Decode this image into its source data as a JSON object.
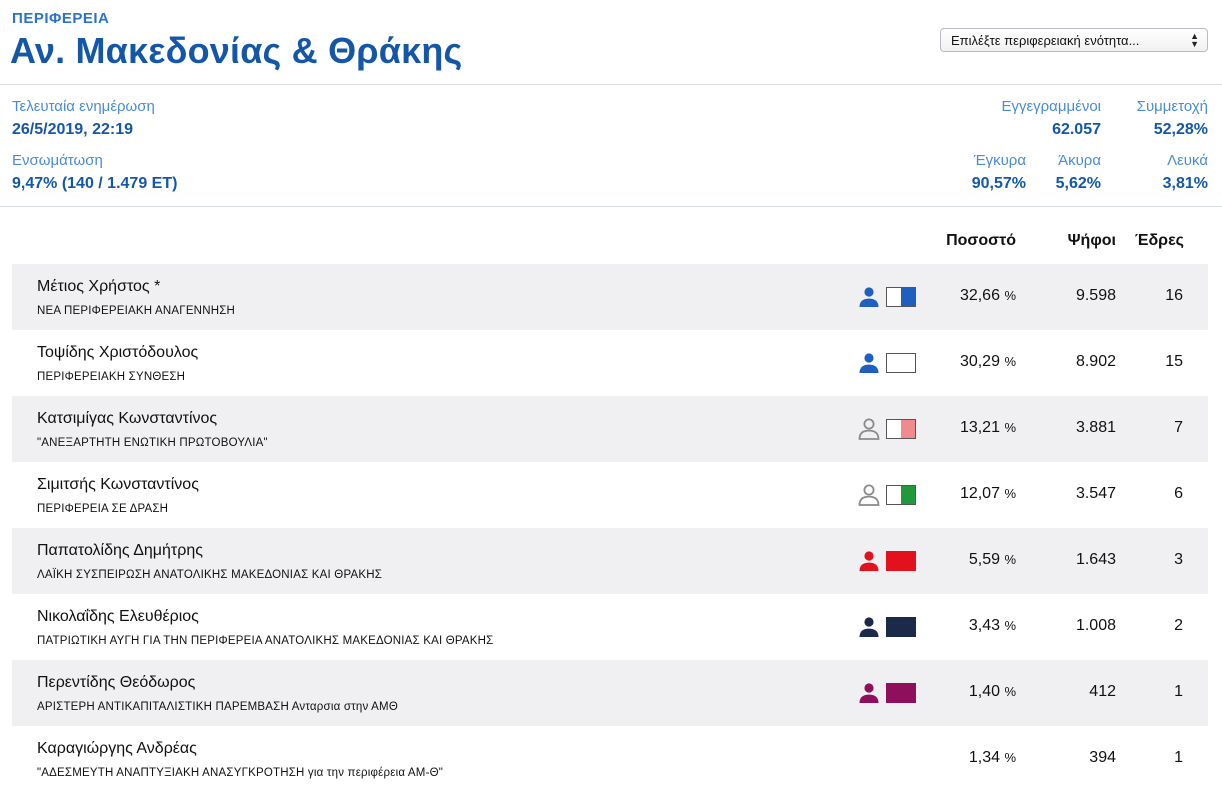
{
  "header": {
    "kicker": "ΠΕΡΙΦΕΡΕΙΑ",
    "title": "Αν. Μακεδονίας & Θράκης",
    "select_value": "Επιλέξτε περιφερειακή ενότητα..."
  },
  "stats": {
    "last_update_label": "Τελευταία ενημέρωση",
    "last_update_value": "26/5/2019, 22:19",
    "incorporation_label": "Ενσωμάτωση",
    "incorporation_value": "9,47% (140 / 1.479 ΕΤ)",
    "registered_label": "Εγγεγραμμένοι",
    "registered_value": "62.057",
    "turnout_label": "Συμμετοχή",
    "turnout_value": "52,28%",
    "valid_label": "Έγκυρα",
    "valid_value": "90,57%",
    "invalid_label": "Άκυρα",
    "invalid_value": "5,62%",
    "blank_label": "Λευκά",
    "blank_value": "3,81%"
  },
  "table": {
    "col_percent": "Ποσοστό",
    "col_votes": "Ψήφοι",
    "col_seats": "Έδρες",
    "percent_unit": "%",
    "rows": [
      {
        "name": "Μέτιος Χρήστος *",
        "party": "ΝΕΑ ΠΕΡΙΦΕΡΕΙΑΚΗ ΑΝΑΓΕΝΝΗΣΗ",
        "percent": "32,66",
        "votes": "9.598",
        "seats": "16",
        "icon": "person-icon",
        "icon_color": "#1f5fbf",
        "icon_filled": true,
        "swatch_color": "#1f5fbf",
        "swatch_share": 0.5
      },
      {
        "name": "Τοψίδης Χριστόδουλος",
        "party": "ΠΕΡΙΦΕΡΕΙΑΚΗ ΣΥΝΘΕΣΗ",
        "percent": "30,29",
        "votes": "8.902",
        "seats": "15",
        "icon": "person-icon",
        "icon_color": "#1f5fbf",
        "icon_filled": true,
        "swatch_color": "#ffffff",
        "swatch_share": 1
      },
      {
        "name": "Κατσιμίγας Κωνσταντίνος",
        "party": "\"ΑΝΕΞΑΡΤΗΤΗ ΕΝΩΤΙΚΗ ΠΡΩΤΟΒΟΥΛΙΑ\"",
        "percent": "13,21",
        "votes": "3.881",
        "seats": "7",
        "icon": "person-outline-icon",
        "icon_color": "#8a8a8a",
        "icon_filled": false,
        "swatch_color": "#f08a8e",
        "swatch_share": 0.5
      },
      {
        "name": "Σιμιτσής Κωνσταντίνος",
        "party": "ΠΕΡΙΦΕΡΕΙΑ ΣΕ ΔΡΑΣΗ",
        "percent": "12,07",
        "votes": "3.547",
        "seats": "6",
        "icon": "person-outline-icon",
        "icon_color": "#8a8a8a",
        "icon_filled": false,
        "swatch_color": "#1e9a3c",
        "swatch_share": 0.5
      },
      {
        "name": "Παπατολίδης Δημήτρης",
        "party": "ΛΑΪΚΗ ΣΥΣΠΕΙΡΩΣΗ ΑΝΑΤΟΛΙΚΗΣ ΜΑΚΕΔΟΝΙΑΣ ΚΑΙ ΘΡΑΚΗΣ",
        "percent": "5,59",
        "votes": "1.643",
        "seats": "3",
        "icon": "person-icon",
        "icon_color": "#e3101d",
        "icon_filled": true,
        "swatch_color": "#e3101d",
        "swatch_share": 1
      },
      {
        "name": "Νικολαΐδης Ελευθέριος",
        "party": "ΠΑΤΡΙΩΤΙΚΗ ΑΥΓΗ ΓΙΑ ΤΗΝ ΠΕΡΙΦΕΡΕΙΑ ΑΝΑΤΟΛΙΚΗΣ ΜΑΚΕΔΟΝΙΑΣ ΚΑΙ ΘΡΑΚΗΣ",
        "percent": "3,43",
        "votes": "1.008",
        "seats": "2",
        "icon": "person-icon",
        "icon_color": "#1c2a4a",
        "icon_filled": true,
        "swatch_color": "#1c2a4a",
        "swatch_share": 1
      },
      {
        "name": "Περεντίδης Θεόδωρος",
        "party": "ΑΡΙΣΤΕΡΗ ΑΝΤΙΚΑΠΙΤΑΛΙΣΤΙΚΗ ΠΑΡΕΜΒΑΣΗ Ανταρσια στην ΑΜΘ",
        "percent": "1,40",
        "votes": "412",
        "seats": "1",
        "icon": "person-icon",
        "icon_color": "#8e0f5c",
        "icon_filled": true,
        "swatch_color": "#8e0f5c",
        "swatch_share": 1
      },
      {
        "name": "Καραγιώργης Ανδρέας",
        "party": "\"ΑΔΕΣΜΕΥΤΗ ΑΝΑΠΤΥΞΙΑΚΗ ΑΝΑΣΥΓΚΡΟΤΗΣΗ για την περιφέρεια ΑΜ-Θ\"",
        "percent": "1,34",
        "votes": "394",
        "seats": "1",
        "icon": null,
        "icon_color": null,
        "icon_filled": false,
        "swatch_color": null,
        "swatch_share": 0
      }
    ]
  }
}
